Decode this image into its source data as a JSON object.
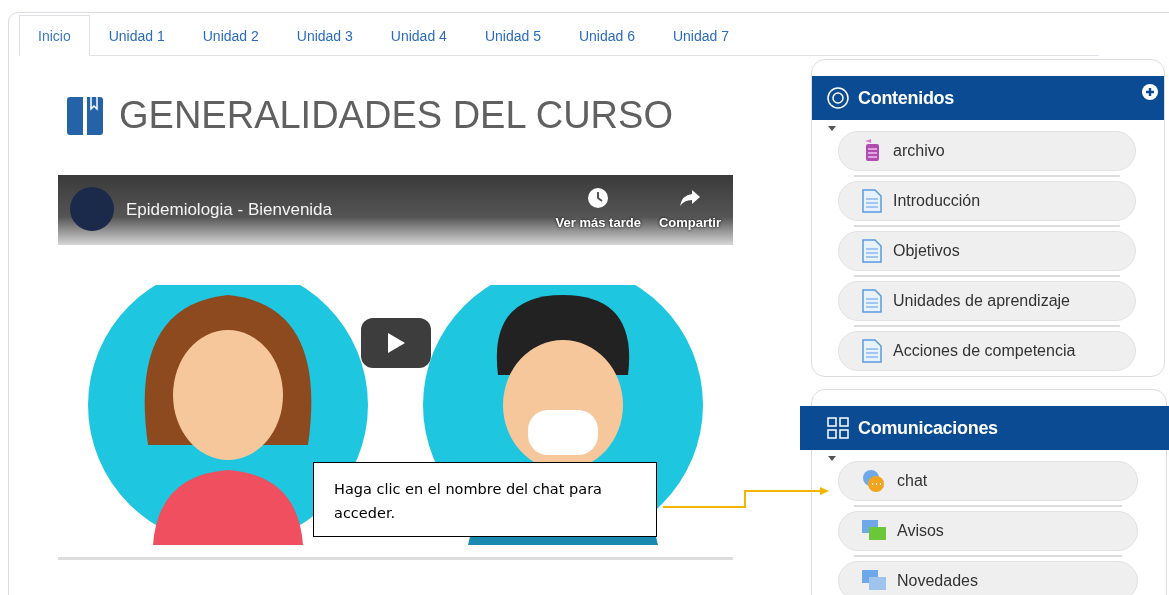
{
  "tabs": [
    {
      "label": "Inicio",
      "selected": true
    },
    {
      "label": "Unidad 1",
      "selected": false
    },
    {
      "label": "Unidad 2",
      "selected": false
    },
    {
      "label": "Unidad 3",
      "selected": false
    },
    {
      "label": "Unidad 4",
      "selected": false
    },
    {
      "label": "Unidad 5",
      "selected": false
    },
    {
      "label": "Unidad 6",
      "selected": false
    },
    {
      "label": "Unidad 7",
      "selected": false
    }
  ],
  "heading": "GENERALIDADES DEL CURSO",
  "video": {
    "title": "Epidemiologia - Bienvenida",
    "actions": [
      {
        "kind": "later",
        "label": "Ver más tarde"
      },
      {
        "kind": "share",
        "label": "Compartir"
      }
    ]
  },
  "blocks": [
    {
      "title": "Contenidos",
      "kind": "contents",
      "items": [
        {
          "kind": "archive",
          "label": "archivo"
        },
        {
          "kind": "page",
          "label": "Introducción"
        },
        {
          "kind": "page",
          "label": "Objetivos"
        },
        {
          "kind": "page",
          "label": "Unidades de aprendizaje"
        },
        {
          "kind": "page",
          "label": "Acciones de competencia"
        }
      ]
    },
    {
      "title": "Comunicaciones",
      "kind": "communications",
      "items": [
        {
          "kind": "chat",
          "label": "chat"
        },
        {
          "kind": "forum",
          "label": "Avisos"
        },
        {
          "kind": "news",
          "label": "Novedades"
        }
      ]
    }
  ],
  "callout": "Haga clic en el nombre del chat para acceder."
}
